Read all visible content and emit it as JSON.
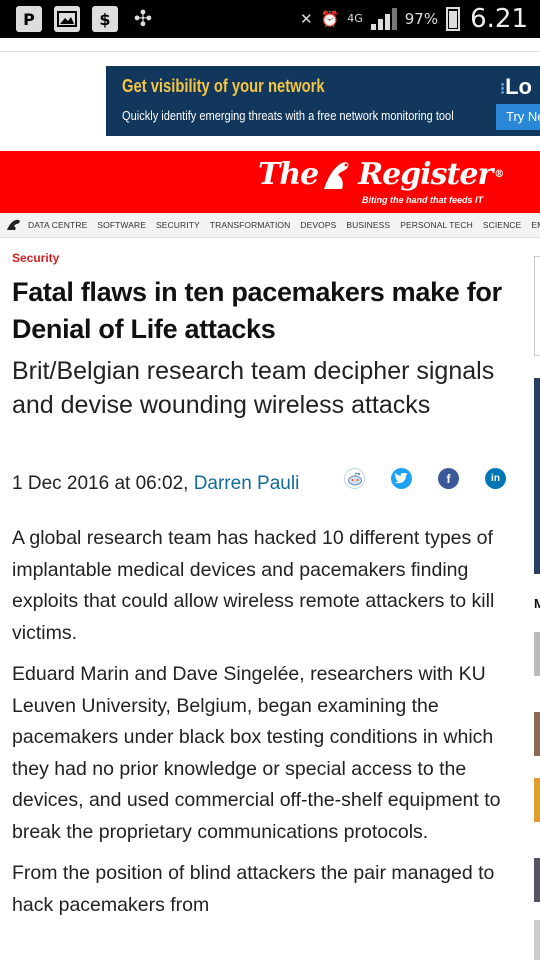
{
  "status_bar": {
    "battery": "97%",
    "network": "4G",
    "time": "6.21"
  },
  "ad": {
    "title": "Get visibility of your network",
    "subtitle": "Quickly identify emerging threats with a free network monitoring tool",
    "logo": "Lo",
    "button": "Try Ne"
  },
  "masthead": {
    "logo_the": "The",
    "logo_register": "Register",
    "logo_reg": "®",
    "tagline": "Biting the hand that feeds IT",
    "color": "#ff0000"
  },
  "nav": {
    "items": [
      "DATA CENTRE",
      "SOFTWARE",
      "SECURITY",
      "TRANSFORMATION",
      "DEVOPS",
      "BUSINESS",
      "PERSONAL TECH",
      "SCIENCE",
      "EMERGENT TECH"
    ]
  },
  "article": {
    "section": "Security",
    "headline": "Fatal flaws in ten pacemakers make for Denial of Life attacks",
    "standfirst": "Brit/Belgian research team decipher signals and devise wounding wireless attacks",
    "date": "1 Dec 2016 at 06:02, ",
    "author": "Darren Pauli",
    "paragraphs": [
      "A global research team has hacked 10 different types of implantable medical devices and pacemakers finding exploits that could allow wireless remote attackers to kill victims.",
      "Eduard Marin and Dave Singelée, researchers with KU Leuven University, Belgium, began examining the pacemakers under black box testing conditions in which they had no prior knowledge or special access to the devices, and used commercial off-the-shelf equipment to break the proprietary communications protocols.",
      "From the position of blind attackers the pair managed to hack pacemakers from"
    ]
  },
  "share": {
    "reddit_icon": "reddit-icon",
    "twitter_icon": "twitter-icon",
    "facebook_icon": "facebook-icon",
    "linkedin_icon": "linkedin-icon"
  },
  "sidebar": {
    "heading_fragment": "M"
  }
}
